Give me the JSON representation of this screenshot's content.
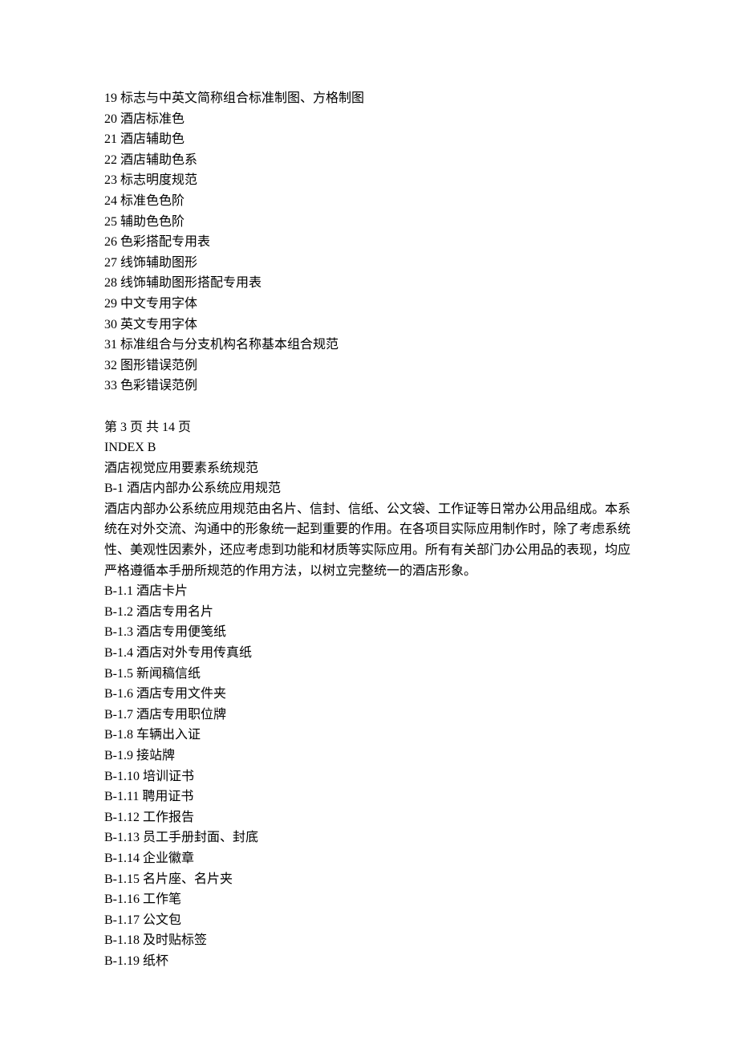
{
  "numbered_items": [
    {
      "num": "19",
      "text": "标志与中英文简称组合标准制图、方格制图"
    },
    {
      "num": "20",
      "text": "酒店标准色"
    },
    {
      "num": "21",
      "text": "酒店辅助色"
    },
    {
      "num": "22",
      "text": "酒店辅助色系"
    },
    {
      "num": "23",
      "text": "标志明度规范"
    },
    {
      "num": "24",
      "text": "标准色色阶"
    },
    {
      "num": "25",
      "text": "辅助色色阶"
    },
    {
      "num": "26",
      "text": "色彩搭配专用表"
    },
    {
      "num": "27",
      "text": "线饰辅助图形"
    },
    {
      "num": "28",
      "text": "线饰辅助图形搭配专用表"
    },
    {
      "num": "29",
      "text": "中文专用字体"
    },
    {
      "num": "30",
      "text": "英文专用字体"
    },
    {
      "num": "31",
      "text": "标准组合与分支机构名称基本组合规范"
    },
    {
      "num": "32",
      "text": "图形错误范例"
    },
    {
      "num": "33",
      "text": "色彩错误范例"
    }
  ],
  "page_line": "第 3 页 共 14 页",
  "index_b": "INDEX B",
  "index_b_title": "酒店视觉应用要素系统规范",
  "b1_heading": "B-1 酒店内部办公系统应用规范",
  "b1_paragraph": "酒店内部办公系统应用规范由名片、信封、信纸、公文袋、工作证等日常办公用品组成。本系统在对外交流、沟通中的形象统一起到重要的作用。在各项目实际应用制作时，除了考虑系统性、美观性因素外，还应考虑到功能和材质等实际应用。所有有关部门办公用品的表现，均应严格遵循本手册所规范的作用方法，以树立完整统一的酒店形象。",
  "b1_items": [
    {
      "code": "B-1.1",
      "text": "酒店卡片"
    },
    {
      "code": "B-1.2",
      "text": "酒店专用名片"
    },
    {
      "code": "B-1.3",
      "text": "酒店专用便笺纸"
    },
    {
      "code": "B-1.4",
      "text": "酒店对外专用传真纸"
    },
    {
      "code": "B-1.5",
      "text": "新闻稿信纸"
    },
    {
      "code": "B-1.6",
      "text": "酒店专用文件夹"
    },
    {
      "code": "B-1.7",
      "text": "酒店专用职位牌"
    },
    {
      "code": "B-1.8",
      "text": "车辆出入证"
    },
    {
      "code": "B-1.9",
      "text": "接站牌"
    },
    {
      "code": "B-1.10",
      "text": "培训证书"
    },
    {
      "code": "B-1.11",
      "text": "聘用证书"
    },
    {
      "code": "B-1.12",
      "text": "工作报告"
    },
    {
      "code": "B-1.13",
      "text": "员工手册封面、封底"
    },
    {
      "code": "B-1.14",
      "text": "企业徽章"
    },
    {
      "code": "B-1.15",
      "text": "名片座、名片夹"
    },
    {
      "code": "B-1.16",
      "text": "工作笔"
    },
    {
      "code": "B-1.17",
      "text": "公文包"
    },
    {
      "code": "B-1.18",
      "text": "及时贴标签"
    },
    {
      "code": "B-1.19",
      "text": "纸杯"
    }
  ]
}
